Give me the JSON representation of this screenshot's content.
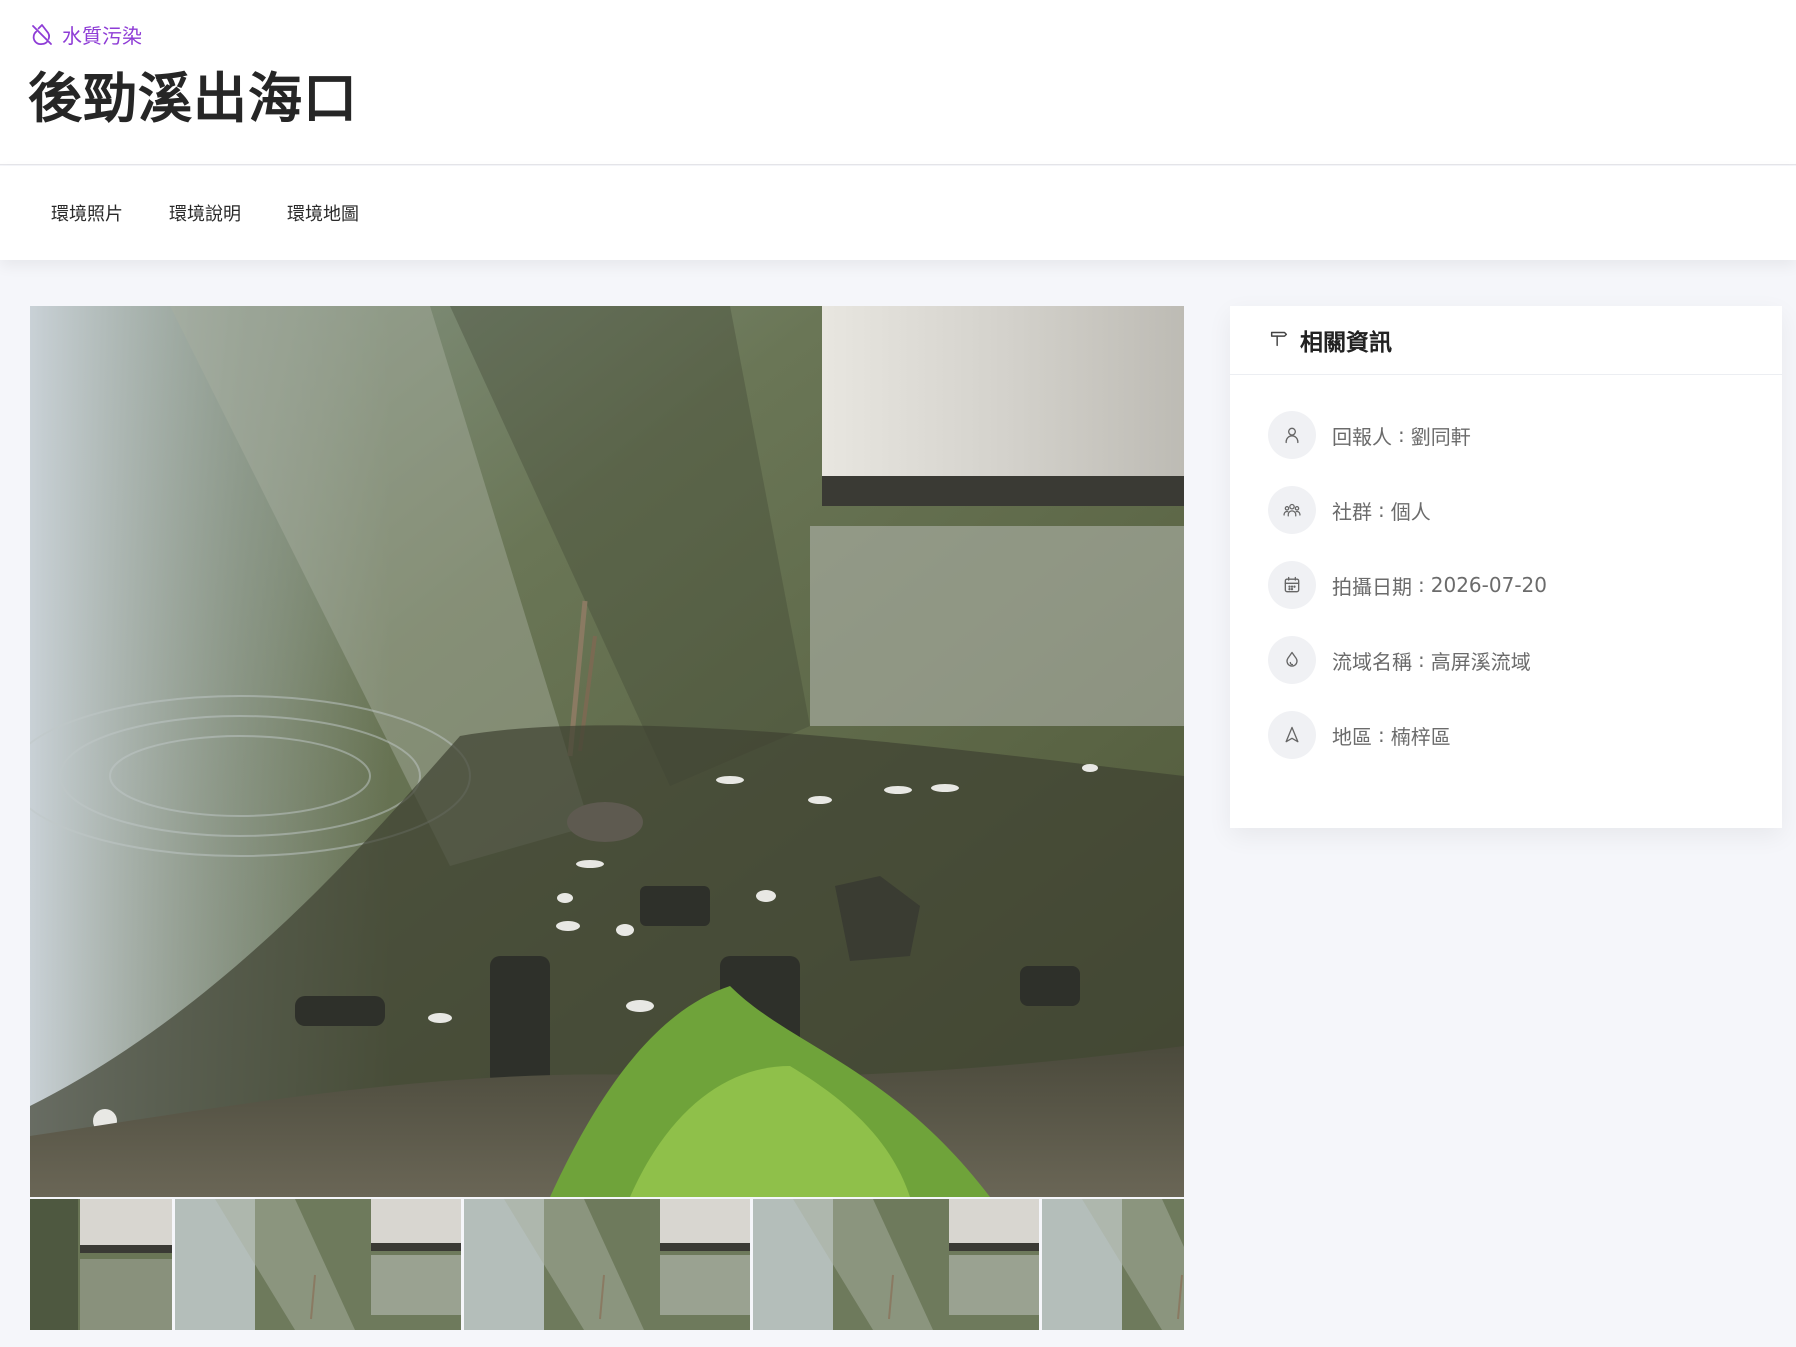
{
  "header": {
    "category": "水質污染",
    "category_icon": "water-off-icon",
    "title": "後勁溪出海口",
    "accent_color": "#8e3cd6"
  },
  "tabs": [
    {
      "label": "環境照片"
    },
    {
      "label": "環境說明"
    },
    {
      "label": "環境地圖"
    }
  ],
  "gallery": {
    "main_photo": "river-under-bridge-with-dead-fish",
    "thumbnail_count": 5
  },
  "info": {
    "title": "相關資訊",
    "title_icon": "signpost-icon",
    "items": [
      {
        "icon": "user-icon",
        "label": "回報人",
        "sep": ":",
        "value": "劉同軒"
      },
      {
        "icon": "group-icon",
        "label": "社群",
        "sep": ":",
        "value": "個人"
      },
      {
        "icon": "calendar-icon",
        "label": "拍攝日期",
        "sep": ":",
        "value": "2026-07-20"
      },
      {
        "icon": "droplet-icon",
        "label": "流域名稱",
        "sep": ":",
        "value": "高屏溪流域"
      },
      {
        "icon": "navigation-icon",
        "label": "地區",
        "sep": ":",
        "value": "楠梓區"
      }
    ]
  }
}
